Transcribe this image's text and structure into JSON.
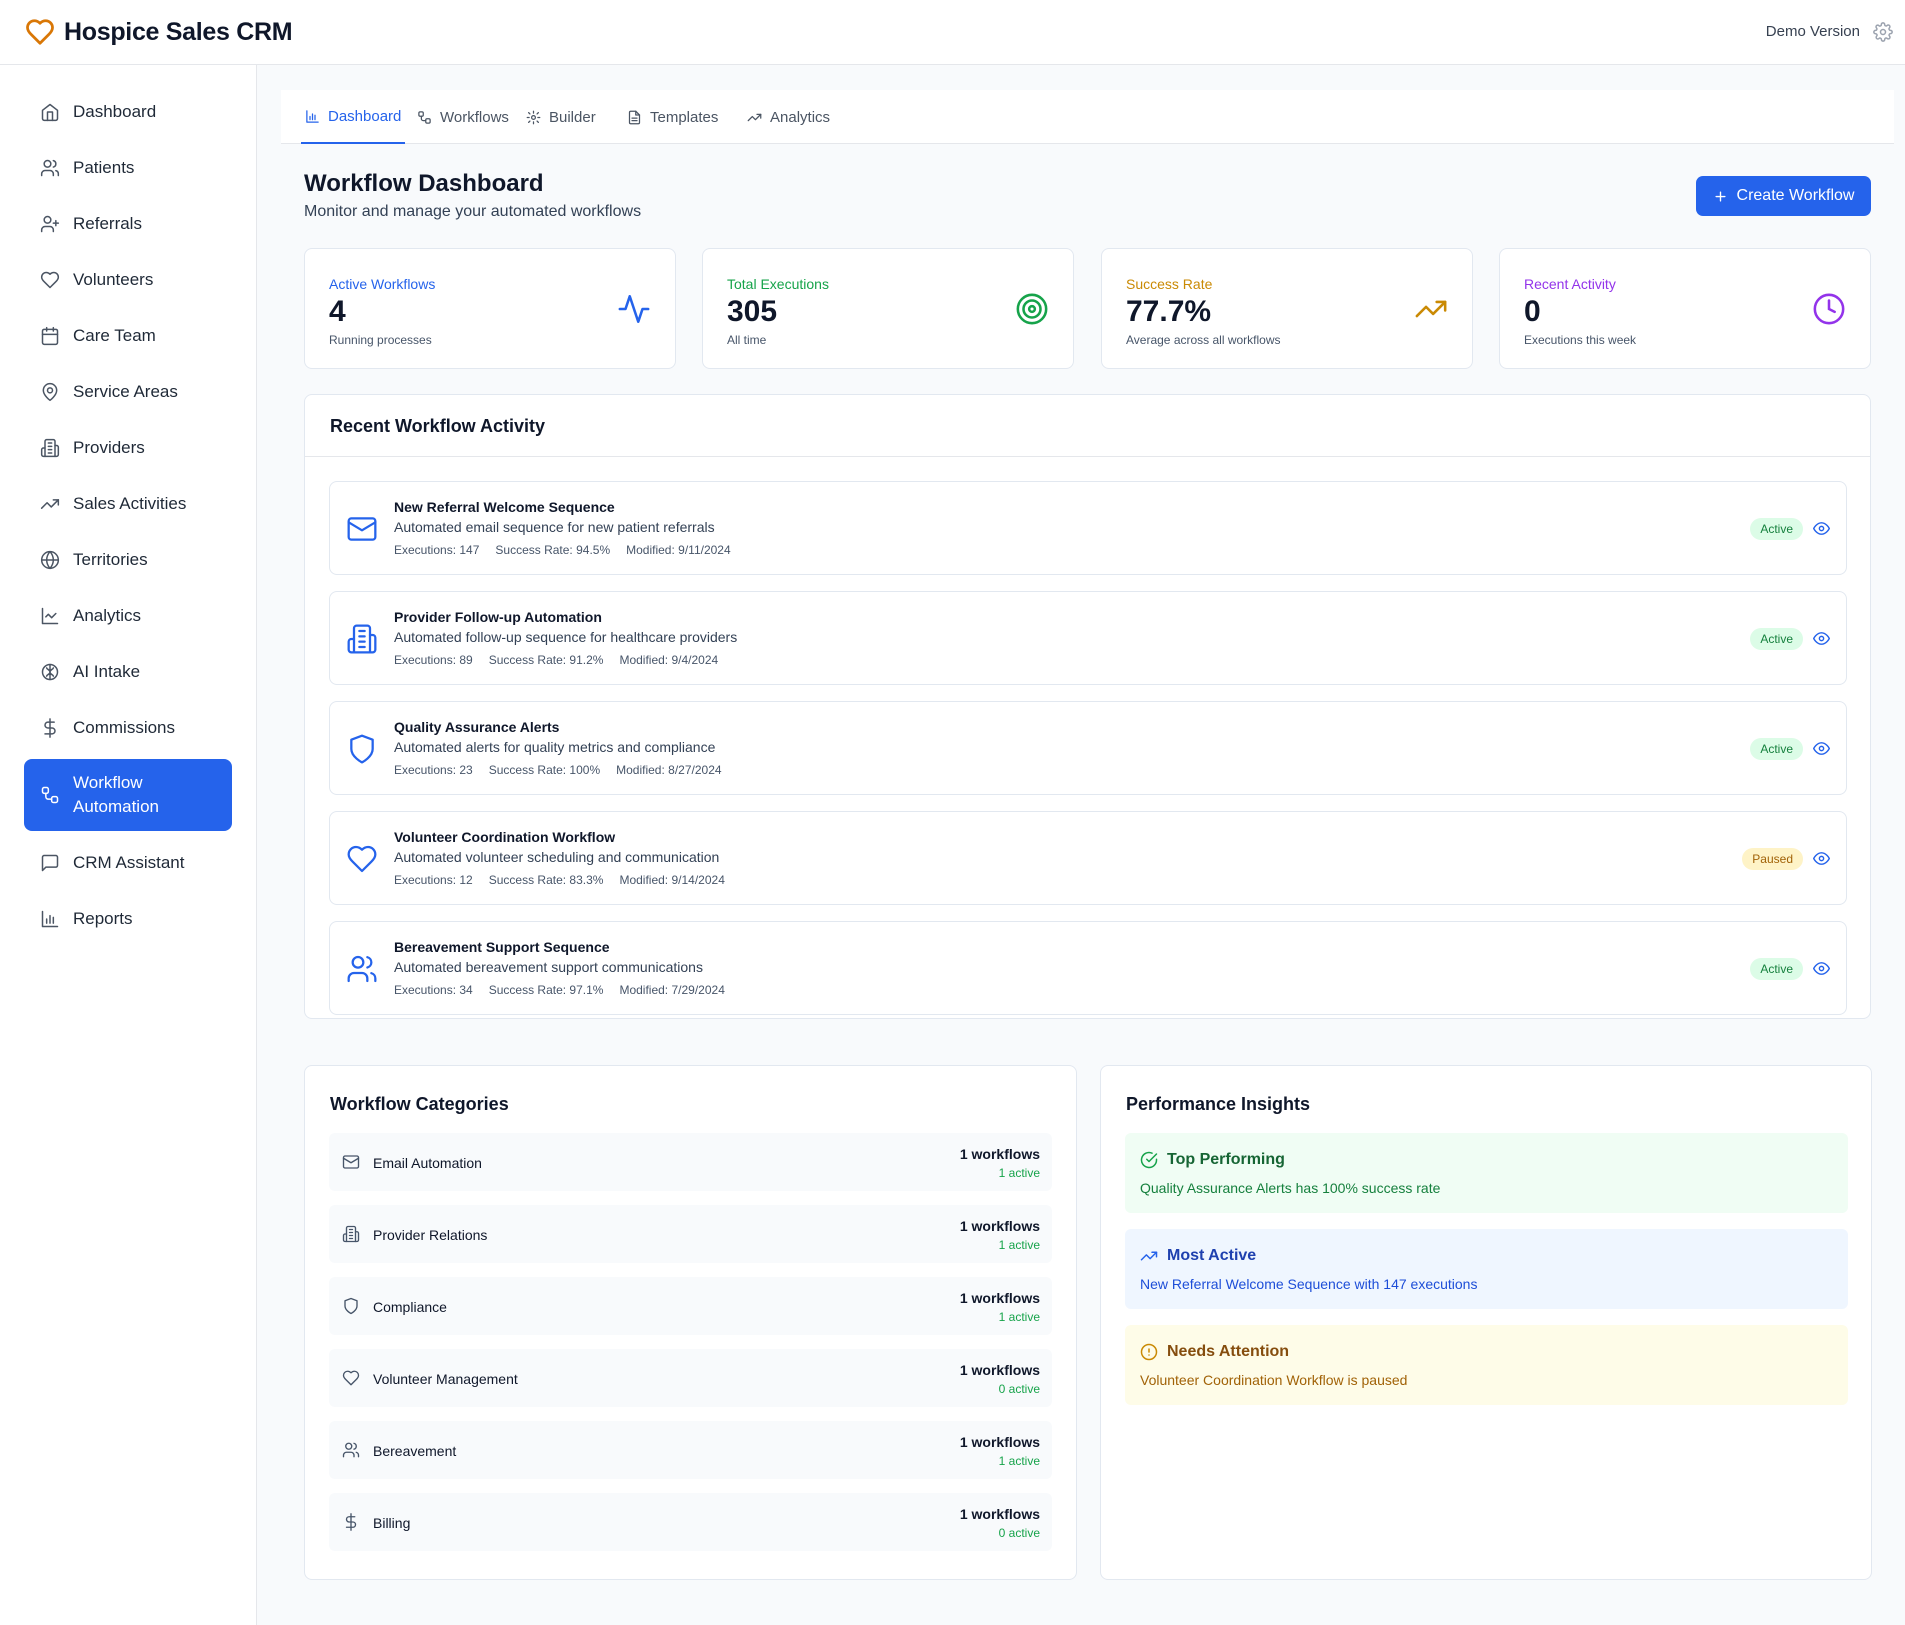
{
  "app": {
    "title": "Hospice Sales CRM",
    "version_label": "Demo Version"
  },
  "sidebar": {
    "items": [
      {
        "label": "Dashboard",
        "icon": "home-icon"
      },
      {
        "label": "Patients",
        "icon": "users-icon"
      },
      {
        "label": "Referrals",
        "icon": "user-plus-icon"
      },
      {
        "label": "Volunteers",
        "icon": "heart-icon"
      },
      {
        "label": "Care Team",
        "icon": "calendar-icon"
      },
      {
        "label": "Service Areas",
        "icon": "map-pin-icon"
      },
      {
        "label": "Providers",
        "icon": "building-icon"
      },
      {
        "label": "Sales Activities",
        "icon": "trending-up-icon"
      },
      {
        "label": "Territories",
        "icon": "globe-icon"
      },
      {
        "label": "Analytics",
        "icon": "line-chart-icon"
      },
      {
        "label": "AI Intake",
        "icon": "brain-icon"
      },
      {
        "label": "Commissions",
        "icon": "dollar-icon"
      },
      {
        "label": "Workflow Automation",
        "icon": "workflow-icon",
        "active": true
      },
      {
        "label": "CRM Assistant",
        "icon": "message-icon"
      },
      {
        "label": "Reports",
        "icon": "bar-chart-icon"
      }
    ]
  },
  "tabs": [
    {
      "label": "Dashboard",
      "icon": "bar-chart-icon",
      "active": true
    },
    {
      "label": "Workflows",
      "icon": "workflow-icon"
    },
    {
      "label": "Builder",
      "icon": "gear-icon"
    },
    {
      "label": "Templates",
      "icon": "document-icon"
    },
    {
      "label": "Analytics",
      "icon": "trending-up-icon"
    }
  ],
  "page": {
    "title": "Workflow Dashboard",
    "subtitle": "Monitor and manage your automated workflows",
    "create_button": "Create Workflow"
  },
  "stats": [
    {
      "label": "Active Workflows",
      "value": "4",
      "sub": "Running processes",
      "color": "#2563eb",
      "icon": "activity-icon"
    },
    {
      "label": "Total Executions",
      "value": "305",
      "sub": "All time",
      "color": "#16a34a",
      "icon": "target-icon"
    },
    {
      "label": "Success Rate",
      "value": "77.7%",
      "sub": "Average across all workflows",
      "color": "#ca8a04",
      "icon": "trending-up-icon"
    },
    {
      "label": "Recent Activity",
      "value": "0",
      "sub": "Executions this week",
      "color": "#9333ea",
      "icon": "clock-icon"
    }
  ],
  "activity": {
    "title": "Recent Workflow Activity",
    "workflows": [
      {
        "name": "New Referral Welcome Sequence",
        "description": "Automated email sequence for new patient referrals",
        "executions": "Executions: 147",
        "success": "Success Rate: 94.5%",
        "modified": "Modified: 9/11/2024",
        "status": "Active",
        "icon": "mail-icon"
      },
      {
        "name": "Provider Follow-up Automation",
        "description": "Automated follow-up sequence for healthcare providers",
        "executions": "Executions: 89",
        "success": "Success Rate: 91.2%",
        "modified": "Modified: 9/4/2024",
        "status": "Active",
        "icon": "building-icon"
      },
      {
        "name": "Quality Assurance Alerts",
        "description": "Automated alerts for quality metrics and compliance",
        "executions": "Executions: 23",
        "success": "Success Rate: 100%",
        "modified": "Modified: 8/27/2024",
        "status": "Active",
        "icon": "shield-icon"
      },
      {
        "name": "Volunteer Coordination Workflow",
        "description": "Automated volunteer scheduling and communication",
        "executions": "Executions: 12",
        "success": "Success Rate: 83.3%",
        "modified": "Modified: 9/14/2024",
        "status": "Paused",
        "icon": "heart-icon"
      },
      {
        "name": "Bereavement Support Sequence",
        "description": "Automated bereavement support communications",
        "executions": "Executions: 34",
        "success": "Success Rate: 97.1%",
        "modified": "Modified: 7/29/2024",
        "status": "Active",
        "icon": "users-icon"
      }
    ]
  },
  "categories": {
    "title": "Workflow Categories",
    "items": [
      {
        "name": "Email Automation",
        "count": "1 workflows",
        "active": "1 active",
        "icon": "mail-icon"
      },
      {
        "name": "Provider Relations",
        "count": "1 workflows",
        "active": "1 active",
        "icon": "building-icon"
      },
      {
        "name": "Compliance",
        "count": "1 workflows",
        "active": "1 active",
        "icon": "shield-icon"
      },
      {
        "name": "Volunteer Management",
        "count": "1 workflows",
        "active": "0 active",
        "icon": "heart-icon"
      },
      {
        "name": "Bereavement",
        "count": "1 workflows",
        "active": "1 active",
        "icon": "users-icon"
      },
      {
        "name": "Billing",
        "count": "1 workflows",
        "active": "0 active",
        "icon": "dollar-icon"
      }
    ]
  },
  "insights": {
    "title": "Performance Insights",
    "items": [
      {
        "heading": "Top Performing",
        "text": "Quality Assurance Alerts has 100% success rate",
        "tone": "green",
        "icon": "check-circle-icon"
      },
      {
        "heading": "Most Active",
        "text": "New Referral Welcome Sequence with 147 executions",
        "tone": "blue",
        "icon": "trending-up-icon"
      },
      {
        "heading": "Needs Attention",
        "text": "Volunteer Coordination Workflow is paused",
        "tone": "yellow",
        "icon": "alert-circle-icon"
      }
    ]
  }
}
